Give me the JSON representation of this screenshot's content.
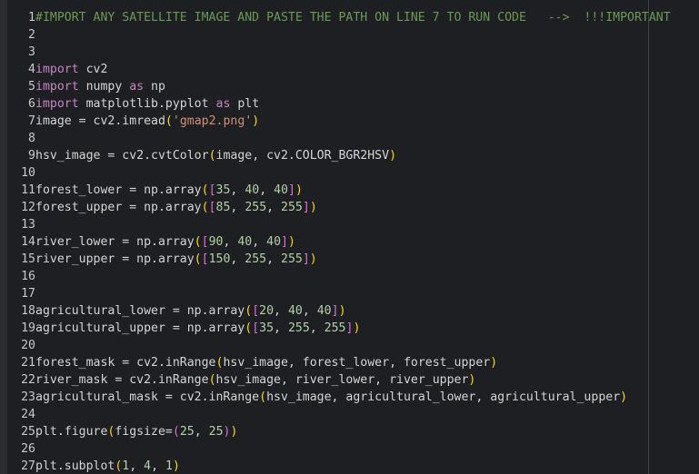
{
  "editor": {
    "lines": [
      {
        "n": "1",
        "tokens": [
          {
            "c": "t-cmt",
            "t": "#IMPORT ANY SATELLITE IMAGE AND PASTE THE PATH ON LINE 7 TO RUN CODE   -->  !!!IMPORTANT"
          }
        ]
      },
      {
        "n": "2",
        "tokens": []
      },
      {
        "n": "3",
        "tokens": []
      },
      {
        "n": "4",
        "tokens": [
          {
            "c": "t-kw",
            "t": "import"
          },
          {
            "c": "t-txt",
            "t": " cv2"
          }
        ]
      },
      {
        "n": "5",
        "tokens": [
          {
            "c": "t-kw",
            "t": "import"
          },
          {
            "c": "t-txt",
            "t": " numpy "
          },
          {
            "c": "t-kw",
            "t": "as"
          },
          {
            "c": "t-txt",
            "t": " np"
          }
        ]
      },
      {
        "n": "6",
        "tokens": [
          {
            "c": "t-kw",
            "t": "import"
          },
          {
            "c": "t-txt",
            "t": " matplotlib.pyplot "
          },
          {
            "c": "t-kw",
            "t": "as"
          },
          {
            "c": "t-txt",
            "t": " plt"
          }
        ]
      },
      {
        "n": "7",
        "tokens": [
          {
            "c": "t-txt",
            "t": "image = cv2.imread"
          },
          {
            "c": "t-brk",
            "t": "("
          },
          {
            "c": "t-str",
            "t": "'gmap2.png'"
          },
          {
            "c": "t-brk",
            "t": ")"
          }
        ]
      },
      {
        "n": "8",
        "tokens": []
      },
      {
        "n": "9",
        "tokens": [
          {
            "c": "t-txt",
            "t": "hsv_image = cv2.cvtColor"
          },
          {
            "c": "t-brk",
            "t": "("
          },
          {
            "c": "t-txt",
            "t": "image, cv2.COLOR_BGR2HSV"
          },
          {
            "c": "t-brk",
            "t": ")"
          }
        ]
      },
      {
        "n": "10",
        "tokens": []
      },
      {
        "n": "11",
        "tokens": [
          {
            "c": "t-txt",
            "t": "forest_lower = np.array"
          },
          {
            "c": "t-brk",
            "t": "("
          },
          {
            "c": "t-brk2",
            "t": "["
          },
          {
            "c": "t-num",
            "t": "35"
          },
          {
            "c": "t-txt",
            "t": ", "
          },
          {
            "c": "t-num",
            "t": "40"
          },
          {
            "c": "t-txt",
            "t": ", "
          },
          {
            "c": "t-num",
            "t": "40"
          },
          {
            "c": "t-brk2",
            "t": "]"
          },
          {
            "c": "t-brk",
            "t": ")"
          }
        ]
      },
      {
        "n": "12",
        "tokens": [
          {
            "c": "t-txt",
            "t": "forest_upper = np.array"
          },
          {
            "c": "t-brk",
            "t": "("
          },
          {
            "c": "t-brk2",
            "t": "["
          },
          {
            "c": "t-num",
            "t": "85"
          },
          {
            "c": "t-txt",
            "t": ", "
          },
          {
            "c": "t-num",
            "t": "255"
          },
          {
            "c": "t-txt",
            "t": ", "
          },
          {
            "c": "t-num",
            "t": "255"
          },
          {
            "c": "t-brk2",
            "t": "]"
          },
          {
            "c": "t-brk",
            "t": ")"
          }
        ]
      },
      {
        "n": "13",
        "tokens": []
      },
      {
        "n": "14",
        "tokens": [
          {
            "c": "t-txt",
            "t": "river_lower = np.array"
          },
          {
            "c": "t-brk",
            "t": "("
          },
          {
            "c": "t-brk2",
            "t": "["
          },
          {
            "c": "t-num",
            "t": "90"
          },
          {
            "c": "t-txt",
            "t": ", "
          },
          {
            "c": "t-num",
            "t": "40"
          },
          {
            "c": "t-txt",
            "t": ", "
          },
          {
            "c": "t-num",
            "t": "40"
          },
          {
            "c": "t-brk2",
            "t": "]"
          },
          {
            "c": "t-brk",
            "t": ")"
          }
        ]
      },
      {
        "n": "15",
        "tokens": [
          {
            "c": "t-txt",
            "t": "river_upper = np.array"
          },
          {
            "c": "t-brk",
            "t": "("
          },
          {
            "c": "t-brk2",
            "t": "["
          },
          {
            "c": "t-num",
            "t": "150"
          },
          {
            "c": "t-txt",
            "t": ", "
          },
          {
            "c": "t-num",
            "t": "255"
          },
          {
            "c": "t-txt",
            "t": ", "
          },
          {
            "c": "t-num",
            "t": "255"
          },
          {
            "c": "t-brk2",
            "t": "]"
          },
          {
            "c": "t-brk",
            "t": ")"
          }
        ]
      },
      {
        "n": "16",
        "tokens": []
      },
      {
        "n": "17",
        "tokens": []
      },
      {
        "n": "18",
        "tokens": [
          {
            "c": "t-txt",
            "t": "agricultural_lower = np.array"
          },
          {
            "c": "t-brk",
            "t": "("
          },
          {
            "c": "t-brk2",
            "t": "["
          },
          {
            "c": "t-num",
            "t": "20"
          },
          {
            "c": "t-txt",
            "t": ", "
          },
          {
            "c": "t-num",
            "t": "40"
          },
          {
            "c": "t-txt",
            "t": ", "
          },
          {
            "c": "t-num",
            "t": "40"
          },
          {
            "c": "t-brk2",
            "t": "]"
          },
          {
            "c": "t-brk",
            "t": ")"
          }
        ]
      },
      {
        "n": "19",
        "tokens": [
          {
            "c": "t-txt",
            "t": "agricultural_upper = np.array"
          },
          {
            "c": "t-brk",
            "t": "("
          },
          {
            "c": "t-brk2",
            "t": "["
          },
          {
            "c": "t-num",
            "t": "35"
          },
          {
            "c": "t-txt",
            "t": ", "
          },
          {
            "c": "t-num",
            "t": "255"
          },
          {
            "c": "t-txt",
            "t": ", "
          },
          {
            "c": "t-num",
            "t": "255"
          },
          {
            "c": "t-brk2",
            "t": "]"
          },
          {
            "c": "t-brk",
            "t": ")"
          }
        ]
      },
      {
        "n": "20",
        "tokens": []
      },
      {
        "n": "21",
        "tokens": [
          {
            "c": "t-txt",
            "t": "forest_mask = cv2.inRange"
          },
          {
            "c": "t-brk",
            "t": "("
          },
          {
            "c": "t-txt",
            "t": "hsv_image, forest_lower, forest_upper"
          },
          {
            "c": "t-brk",
            "t": ")"
          }
        ]
      },
      {
        "n": "22",
        "tokens": [
          {
            "c": "t-txt",
            "t": "river_mask = cv2.inRange"
          },
          {
            "c": "t-brk",
            "t": "("
          },
          {
            "c": "t-txt",
            "t": "hsv_image, river_lower, river_upper"
          },
          {
            "c": "t-brk",
            "t": ")"
          }
        ]
      },
      {
        "n": "23",
        "tokens": [
          {
            "c": "t-txt",
            "t": "agricultural_mask = cv2.inRange"
          },
          {
            "c": "t-brk",
            "t": "("
          },
          {
            "c": "t-txt",
            "t": "hsv_image, agricultural_lower, agricultural_upper"
          },
          {
            "c": "t-brk",
            "t": ")"
          }
        ]
      },
      {
        "n": "24",
        "tokens": []
      },
      {
        "n": "25",
        "tokens": [
          {
            "c": "t-txt",
            "t": "plt.figure"
          },
          {
            "c": "t-brk",
            "t": "("
          },
          {
            "c": "t-txt",
            "t": "figsize="
          },
          {
            "c": "t-brk2",
            "t": "("
          },
          {
            "c": "t-num",
            "t": "25"
          },
          {
            "c": "t-txt",
            "t": ", "
          },
          {
            "c": "t-num",
            "t": "25"
          },
          {
            "c": "t-brk2",
            "t": ")"
          },
          {
            "c": "t-brk",
            "t": ")"
          }
        ]
      },
      {
        "n": "26",
        "tokens": []
      },
      {
        "n": "27",
        "tokens": [
          {
            "c": "t-txt",
            "t": "plt.subplot"
          },
          {
            "c": "t-brk",
            "t": "("
          },
          {
            "c": "t-num",
            "t": "1"
          },
          {
            "c": "t-txt",
            "t": ", "
          },
          {
            "c": "t-num",
            "t": "4"
          },
          {
            "c": "t-txt",
            "t": ", "
          },
          {
            "c": "t-num",
            "t": "1"
          },
          {
            "c": "t-brk",
            "t": ")"
          }
        ]
      }
    ]
  }
}
